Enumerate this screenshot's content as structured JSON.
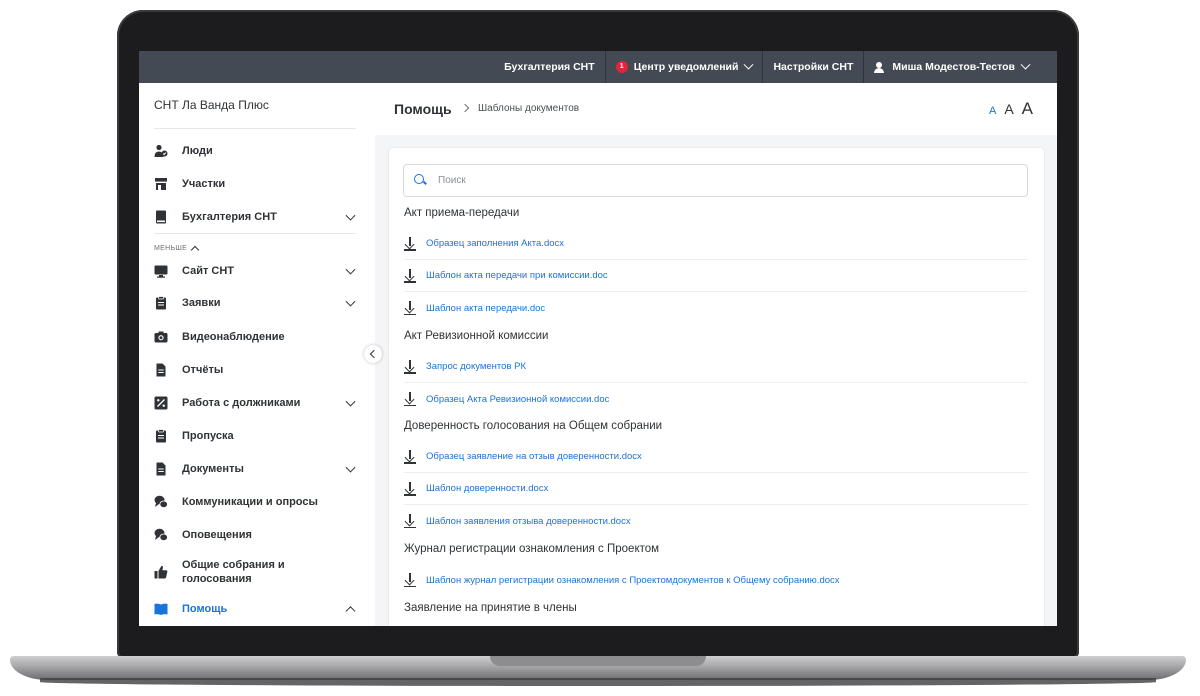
{
  "topbar": {
    "accounting": "Бухгалтерия СНТ",
    "notifications": "Центр уведомлений",
    "notifications_count": "1",
    "settings": "Настройки СНТ",
    "user": "Миша Модестов-Тестов"
  },
  "sidebar": {
    "org": "СНТ Ла Ванда Плюс",
    "less": "МЕНЬШЕ",
    "items": [
      {
        "label": "Люди",
        "icon": "people-icon"
      },
      {
        "label": "Участки",
        "icon": "store-icon"
      },
      {
        "label": "Бухгалтерия СНТ",
        "icon": "book-icon"
      },
      {
        "label": "Сайт СНТ",
        "icon": "monitor-icon"
      },
      {
        "label": "Заявки",
        "icon": "clipboard-icon"
      },
      {
        "label": "Видеонаблюдение",
        "icon": "camera-icon"
      },
      {
        "label": "Отчёты",
        "icon": "file-icon"
      },
      {
        "label": "Работа с должниками",
        "icon": "percent-icon"
      },
      {
        "label": "Пропуска",
        "icon": "clipboard-icon"
      },
      {
        "label": "Документы",
        "icon": "file-icon"
      },
      {
        "label": "Коммуникации и опросы",
        "icon": "chat-icon"
      },
      {
        "label": "Оповещения",
        "icon": "chat-icon"
      },
      {
        "label": "Общие собрания и голосования",
        "icon": "thumbs-up-icon"
      },
      {
        "label": "Помощь",
        "icon": "open-book-icon"
      }
    ]
  },
  "header": {
    "title": "Помощь",
    "breadcrumb": "Шаблоны документов",
    "font_small": "A",
    "font_medium": "A",
    "font_large": "A"
  },
  "search": {
    "placeholder": "Поиск"
  },
  "sections": [
    {
      "title": "Акт приема-передачи",
      "files": [
        "Образец заполнения Акта.docx",
        "Шаблон акта передачи при комиссии.doc",
        "Шаблон акта передачи.doc"
      ]
    },
    {
      "title": "Акт Ревизионной комиссии",
      "files": [
        "Запрос документов РК",
        "Образец Акта Ревизионной комиссии.doc"
      ]
    },
    {
      "title": "Доверенность голосования на Общем собрании",
      "files": [
        "Образец заявление на отзыв доверенности.docx",
        "Шаблон доверенности.docx",
        "Шаблон заявления отзыва доверенности.docx"
      ]
    },
    {
      "title": "Журнал регистрации ознакомления с Проектом",
      "files": [
        "Шаблон журнал регистрации ознакомления с Проектомдокументов к Общему собранию.docx"
      ]
    },
    {
      "title": "Заявление на принятие в члены",
      "files": []
    }
  ],
  "colors": {
    "accent": "#1a73d9",
    "topbar": "#434a53",
    "badge": "#e0243a"
  }
}
